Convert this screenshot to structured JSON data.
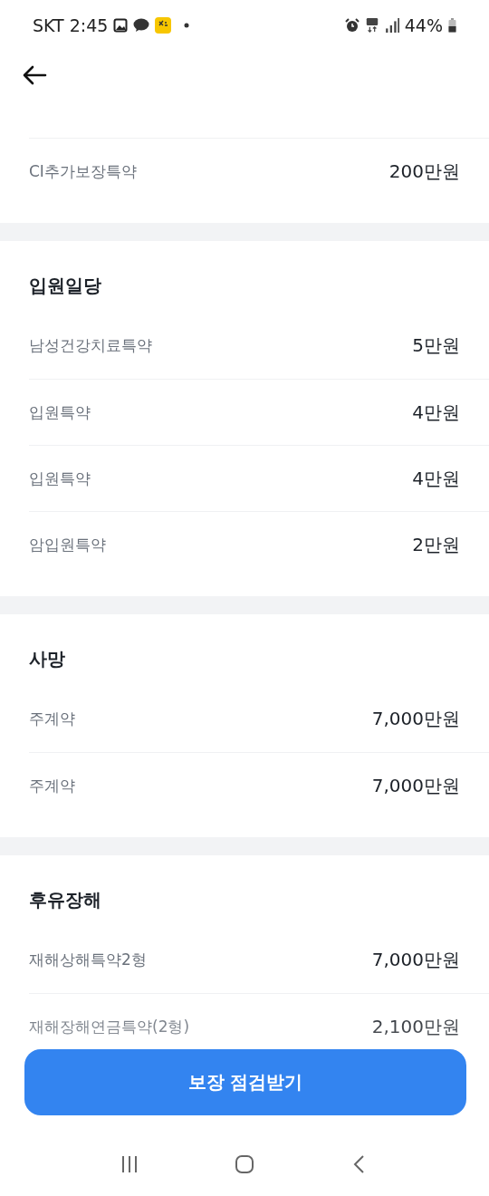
{
  "status_bar": {
    "carrier": "SKT",
    "time": "2:45",
    "battery": "44%"
  },
  "sections": [
    {
      "rows": [
        {
          "name": "CI추가보장특약",
          "amount": "200만원"
        }
      ]
    },
    {
      "title": "입원일당",
      "rows": [
        {
          "name": "남성건강치료특약",
          "amount": "5만원"
        },
        {
          "name": "입원특약",
          "amount": "4만원"
        },
        {
          "name": "입원특약",
          "amount": "4만원"
        },
        {
          "name": "암입원특약",
          "amount": "2만원"
        }
      ]
    },
    {
      "title": "사망",
      "rows": [
        {
          "name": "주계약",
          "amount": "7,000만원"
        },
        {
          "name": "주계약",
          "amount": "7,000만원"
        }
      ]
    },
    {
      "title": "후유장해",
      "rows": [
        {
          "name": "재해상해특약2형",
          "amount": "7,000만원"
        },
        {
          "name": "재해장해연금특약(2형)",
          "amount": "2,100만원"
        }
      ]
    }
  ],
  "primary_button": "보장 점검받기"
}
